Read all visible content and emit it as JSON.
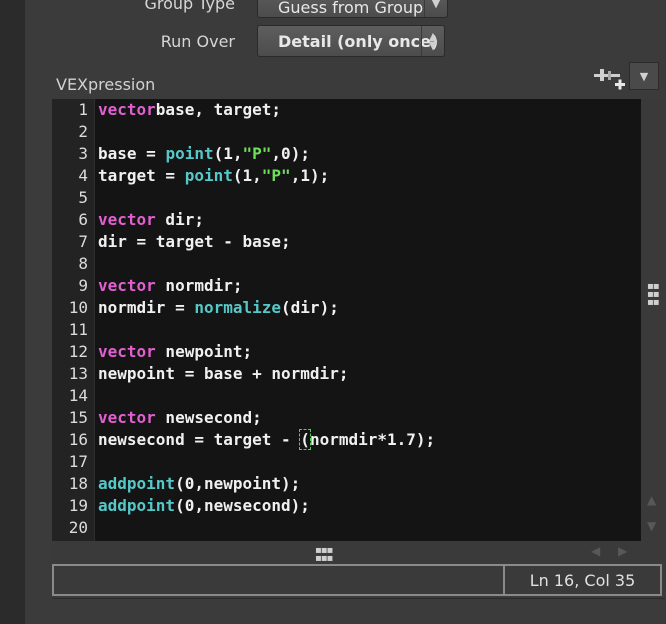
{
  "params": {
    "group_type": {
      "label": "Group Type",
      "value": "Guess from Group"
    },
    "run_over": {
      "label": "Run Over",
      "value": "Detail (only once)"
    }
  },
  "vex": {
    "label": "VEXpression"
  },
  "status": {
    "position": "Ln 16, Col 35"
  },
  "code_lines": [
    {
      "n": "1",
      "tokens": [
        [
          "kw",
          "vector"
        ],
        [
          "",
          "base, target;"
        ]
      ]
    },
    {
      "n": "2",
      "tokens": []
    },
    {
      "n": "3",
      "tokens": [
        [
          "",
          "base = "
        ],
        [
          "fn",
          "point"
        ],
        [
          "",
          "(1,"
        ],
        [
          "str",
          "\"P\""
        ],
        [
          "",
          ",0);"
        ]
      ]
    },
    {
      "n": "4",
      "tokens": [
        [
          "",
          "target = "
        ],
        [
          "fn",
          "point"
        ],
        [
          "",
          "(1,"
        ],
        [
          "str",
          "\"P\""
        ],
        [
          "",
          ",1);"
        ]
      ]
    },
    {
      "n": "5",
      "tokens": []
    },
    {
      "n": "6",
      "tokens": [
        [
          "kw",
          "vector"
        ],
        [
          "",
          " dir;"
        ]
      ]
    },
    {
      "n": "7",
      "tokens": [
        [
          "",
          "dir = target - base;"
        ]
      ]
    },
    {
      "n": "8",
      "tokens": []
    },
    {
      "n": "9",
      "tokens": [
        [
          "kw",
          "vector"
        ],
        [
          "",
          " normdir;"
        ]
      ]
    },
    {
      "n": "10",
      "tokens": [
        [
          "",
          "normdir = "
        ],
        [
          "fn",
          "normalize"
        ],
        [
          "",
          "(dir);"
        ]
      ]
    },
    {
      "n": "11",
      "tokens": []
    },
    {
      "n": "12",
      "tokens": [
        [
          "kw",
          "vector"
        ],
        [
          "",
          " newpoint;"
        ]
      ]
    },
    {
      "n": "13",
      "tokens": [
        [
          "",
          "newpoint = base + normdir;"
        ]
      ]
    },
    {
      "n": "14",
      "tokens": []
    },
    {
      "n": "15",
      "tokens": [
        [
          "kw",
          "vector"
        ],
        [
          "",
          " newsecond;"
        ]
      ]
    },
    {
      "n": "16",
      "tokens": [
        [
          "",
          "newsecond = target - "
        ],
        [
          "cursor",
          "("
        ],
        [
          "",
          "normdir*1.7);"
        ]
      ]
    },
    {
      "n": "17",
      "tokens": []
    },
    {
      "n": "18",
      "tokens": [
        [
          "fn",
          "addpoint"
        ],
        [
          "",
          "(0,newpoint);"
        ]
      ]
    },
    {
      "n": "19",
      "tokens": [
        [
          "fn",
          "addpoint"
        ],
        [
          "",
          "(0,newsecond);"
        ]
      ]
    },
    {
      "n": "20",
      "tokens": []
    }
  ]
}
